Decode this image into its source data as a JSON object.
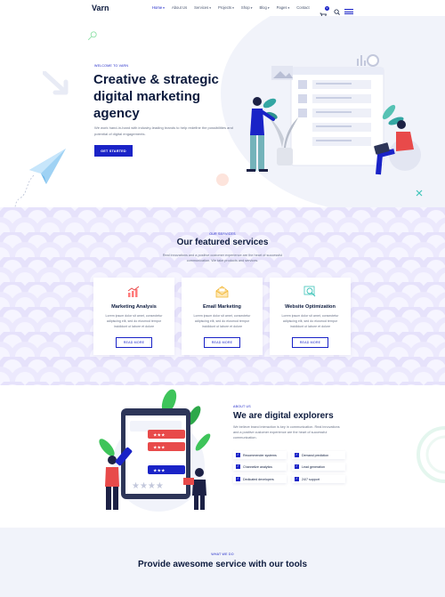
{
  "nav": {
    "logo": "Varn",
    "items": [
      {
        "label": "Home",
        "dropdown": true,
        "active": true
      },
      {
        "label": "About Us",
        "dropdown": false,
        "active": false
      },
      {
        "label": "Services",
        "dropdown": true,
        "active": false
      },
      {
        "label": "Projects",
        "dropdown": true,
        "active": false
      },
      {
        "label": "Shop",
        "dropdown": true,
        "active": false
      },
      {
        "label": "Blog",
        "dropdown": true,
        "active": false
      },
      {
        "label": "Pages",
        "dropdown": true,
        "active": false
      },
      {
        "label": "Contact",
        "dropdown": false,
        "active": false
      }
    ],
    "cart_count": "0",
    "icons": [
      "cart-icon",
      "search-icon",
      "menu-icon"
    ]
  },
  "hero": {
    "eyebrow": "WELCOME TO VARN",
    "title": "Creative & strategic digital marketing agency",
    "description": "We work hand-in-hand with industry-leading brands to help redefine the possibilities and potential of digital engagements.",
    "cta": "GET STARTED"
  },
  "services": {
    "eyebrow": "OUR SERVICES",
    "title": "Our featured services",
    "description": "Real innovations and a positive customer experience are the heart of successful communication. We take products and services.",
    "cards": [
      {
        "title": "Marketing Analysis",
        "text": "Lorem ipsum dolor sit amet, consectetur adipiscing elit, sed do eiusmod tempor incididunt ut labore et dolore",
        "button": "READ MORE",
        "icon": "chart-icon"
      },
      {
        "title": "Email Marketing",
        "text": "Lorem ipsum dolor sit amet, consectetur adipiscing elit, sed do eiusmod tempor incididunt ut labore et dolore",
        "button": "READ MORE",
        "icon": "mail-icon"
      },
      {
        "title": "Website Optimization",
        "text": "Lorem ipsum dolor sit amet, consectetur adipiscing elit, sed do eiusmod tempor incididunt ut labore et dolore",
        "button": "READ MORE",
        "icon": "search-optimization-icon"
      }
    ]
  },
  "about": {
    "eyebrow": "ABOUT US",
    "title": "We are digital explorers",
    "description": "We believe brand interaction is key in communication. Real innovations and a positive customer experience are the heart of successful communication.",
    "features": [
      "Recommender systems",
      "Demand prediction",
      "Channelize analytics",
      "Lead generation",
      "Dedicated developers",
      "24/7 support"
    ]
  },
  "what_we_do": {
    "eyebrow": "WHAT WE DO",
    "title": "Provide awesome service with our tools"
  },
  "colors": {
    "primary": "#1a23c7",
    "heading": "#0d1b3e",
    "body": "#6b7489",
    "accent_red": "#e84a4a",
    "accent_green": "#3ec45a",
    "tint_bg": "#f1f3fa"
  }
}
